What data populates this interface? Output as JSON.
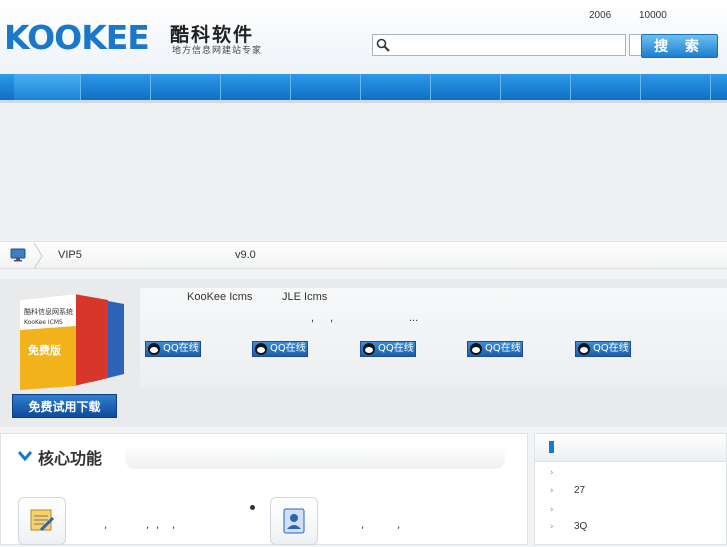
{
  "header": {
    "logo_text": "KOOKEE",
    "logo_cn": "酷科软件",
    "logo_tagline": "地方信息网建站专家",
    "stat_1": "2006",
    "stat_2": "10000",
    "search": {
      "placeholder": "",
      "button_label": "搜 索"
    }
  },
  "breadcrumb": {
    "item_1": "VIP5",
    "item_2": "v9.0"
  },
  "product": {
    "names": [
      "KooKee Icms",
      "JLE Icms"
    ],
    "dots_1": ",",
    "dots_2": ",",
    "dots_3": "...",
    "qq_label": "QQ在线",
    "box_line_1": "酷科信息网系统",
    "box_line_2": "KooKee ICMS",
    "box_badge": "免费版",
    "trial_label": "免费试用下载"
  },
  "core": {
    "title": "核心功能",
    "text_1": ",",
    "text_2": ",",
    "text_3": ",",
    "text_4": ",",
    "text_5": ",",
    "text_6": ","
  },
  "sidebar": {
    "items": [
      "",
      "27",
      "",
      "3Q"
    ]
  },
  "colors": {
    "brand_blue": "#1b78c9",
    "nav_blue": "#0f6fc4"
  }
}
